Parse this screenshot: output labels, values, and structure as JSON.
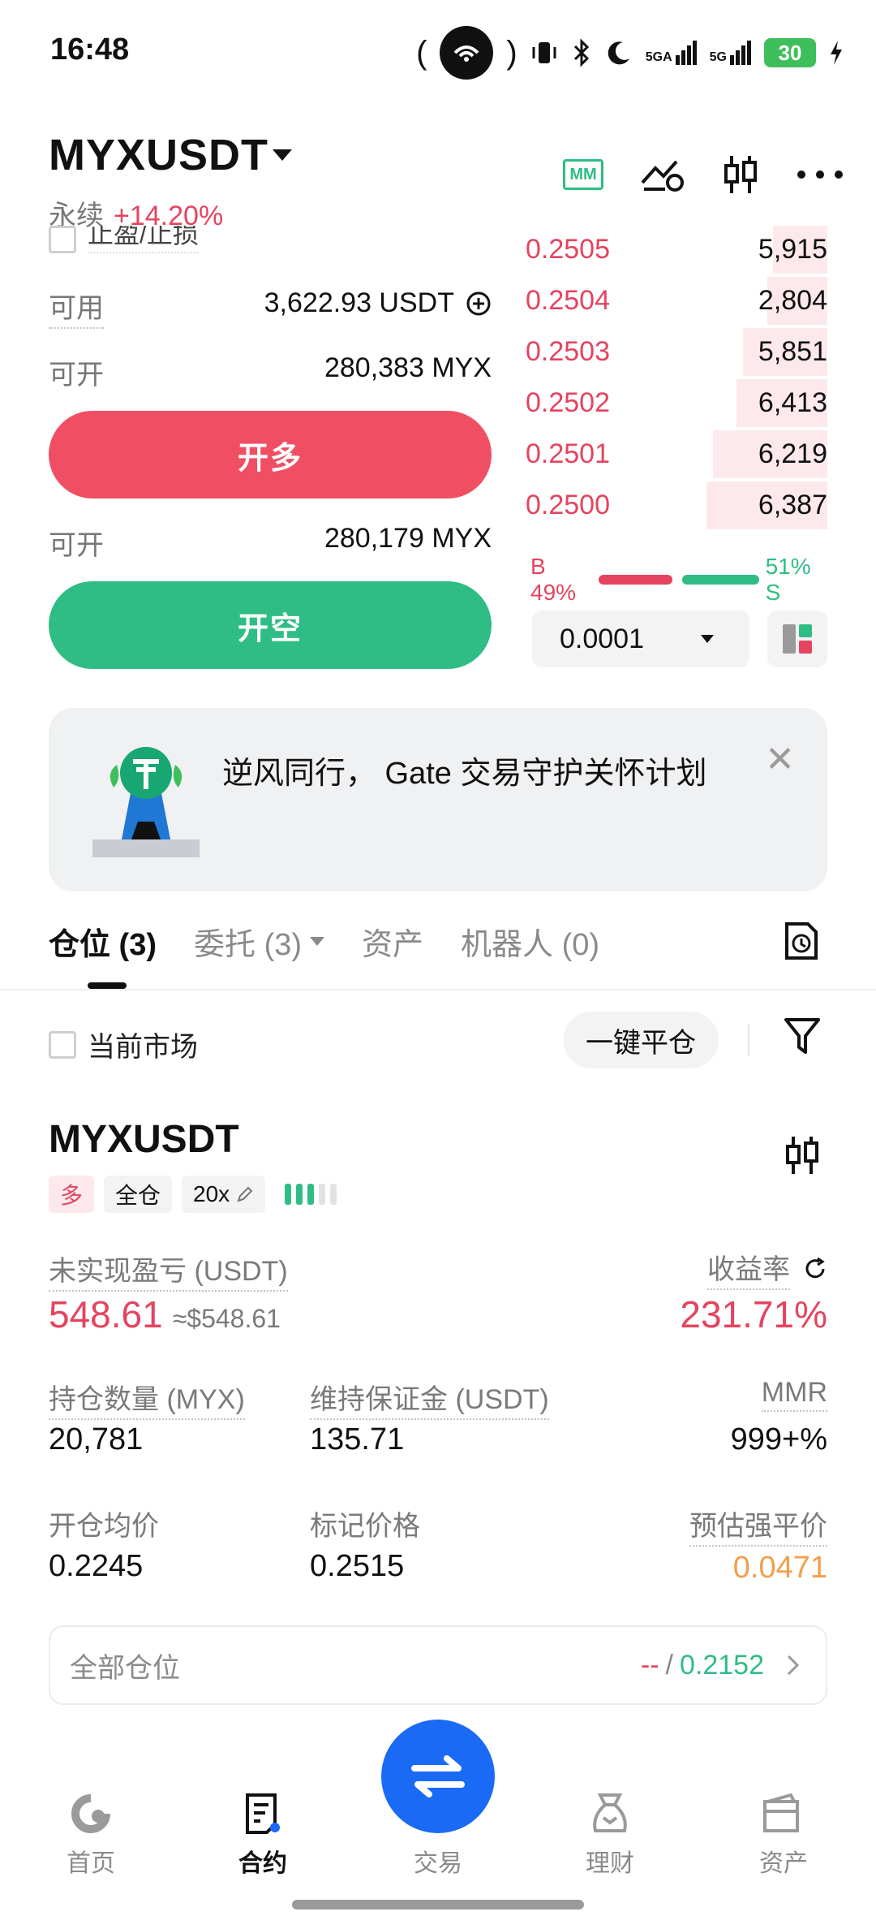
{
  "status_bar": {
    "time": "16:48",
    "network_1": "5GA",
    "network_2": "5G",
    "battery": "30"
  },
  "header": {
    "symbol": "MYXUSDT",
    "type": "永续",
    "change": "+14.20%"
  },
  "trade_panel": {
    "tpsl_label": "止盈/止损",
    "available_label": "可用",
    "available_value": "3,622.93 USDT",
    "open_label_long": "可开",
    "open_value_long": "280,383 MYX",
    "long_button": "开多",
    "open_label_short": "可开",
    "open_value_short": "280,179 MYX",
    "short_button": "开空"
  },
  "order_book": {
    "asks": [
      {
        "price": "0.2505",
        "size": "5,915",
        "depth": 0.18
      },
      {
        "price": "0.2504",
        "size": "2,804",
        "depth": 0.2
      },
      {
        "price": "0.2503",
        "size": "5,851",
        "depth": 0.28
      },
      {
        "price": "0.2502",
        "size": "6,413",
        "depth": 0.3
      },
      {
        "price": "0.2501",
        "size": "6,219",
        "depth": 0.38
      },
      {
        "price": "0.2500",
        "size": "6,387",
        "depth": 0.4
      }
    ],
    "buy_ratio_label": "B 49%",
    "sell_ratio_label": "51% S",
    "buy_ratio": 0.49,
    "sell_ratio": 0.51,
    "precision": "0.0001"
  },
  "banner": {
    "text": "逆风同行， Gate 交易守护关怀计划"
  },
  "tabs": [
    {
      "label": "仓位 (3)"
    },
    {
      "label": "委托 (3)"
    },
    {
      "label": "资产"
    },
    {
      "label": "机器人 (0)"
    }
  ],
  "filter": {
    "current_market": "当前市场",
    "close_all": "一键平仓"
  },
  "position": {
    "symbol": "MYXUSDT",
    "side": "多",
    "margin_mode": "全仓",
    "leverage": "20x",
    "unrealized_pnl_label": "未实现盈亏 (USDT)",
    "unrealized_pnl": "548.61",
    "unrealized_pnl_usd": "≈$548.61",
    "roe_label": "收益率",
    "roe": "231.71%",
    "size_label": "持仓数量 (MYX)",
    "size": "20,781",
    "maint_margin_label": "维持保证金 (USDT)",
    "maint_margin": "135.71",
    "mmr_label": "MMR",
    "mmr": "999+%",
    "entry_label": "开仓均价",
    "entry": "0.2245",
    "mark_label": "标记价格",
    "mark": "0.2515",
    "liq_label": "预估强平价",
    "liq": "0.0471"
  },
  "all_positions": {
    "label": "全部仓位",
    "value_a": "--",
    "separator": "/",
    "value_b": "0.2152"
  },
  "nav": {
    "home": "首页",
    "futures": "合约",
    "trade": "交易",
    "earn": "理财",
    "assets": "资产"
  },
  "colors": {
    "red": "#e4445f",
    "green": "#2fbd85",
    "blue": "#1a6af5",
    "orange": "#f0a04b"
  }
}
